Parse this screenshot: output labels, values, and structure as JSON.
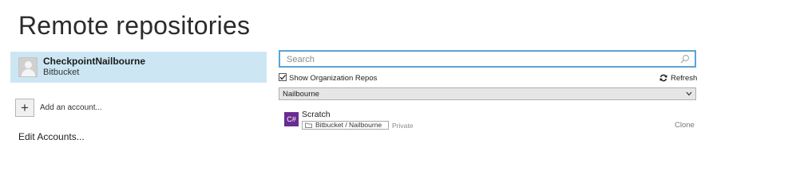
{
  "page": {
    "title": "Remote repositories"
  },
  "accounts": {
    "selected": {
      "name": "CheckpointNailbourne",
      "host": "Bitbucket"
    },
    "add_label": "Add an account...",
    "add_button_icon": "plus-icon",
    "edit_label": "Edit Accounts..."
  },
  "repos": {
    "search": {
      "placeholder": "Search",
      "value": "",
      "icon": "search-icon"
    },
    "show_org_repos": {
      "label": "Show Organization Repos",
      "checked": true
    },
    "refresh": {
      "label": "Refresh",
      "icon": "refresh-icon"
    },
    "organization": {
      "selected": "Nailbourne"
    },
    "items": [
      {
        "icon_text": "C#",
        "icon_color": "#6a2c91",
        "name": "Scratch",
        "path": "Bitbucket / Nailbourne",
        "visibility": "Private",
        "action": "Clone"
      }
    ]
  },
  "colors": {
    "selection_bg": "#cde6f4",
    "search_focus_border": "#5aa4d6",
    "repo_icon_bg": "#6a2c91"
  }
}
